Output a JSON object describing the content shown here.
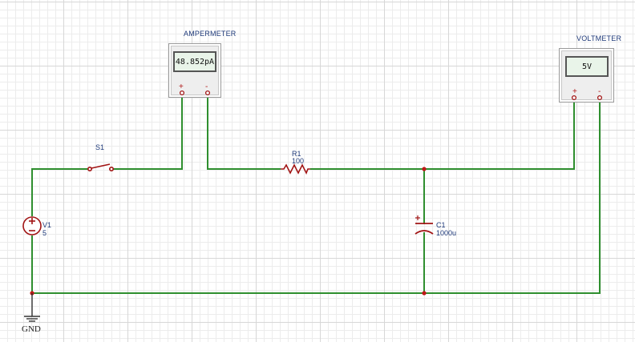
{
  "ammeter": {
    "title": "AMPERMETER",
    "reading": "48.852pA",
    "plus": "+",
    "minus": "-"
  },
  "voltmeter": {
    "title": "VOLTMETER",
    "reading": "5V",
    "plus": "+",
    "minus": "-"
  },
  "switch": {
    "label": "S1"
  },
  "resistor": {
    "label": "R1",
    "value": "100"
  },
  "capacitor": {
    "label": "C1",
    "value": "1000u"
  },
  "source": {
    "label": "V1",
    "value": "5"
  },
  "ground": {
    "label": "GND"
  },
  "colors": {
    "wire": "#2f8f2f",
    "component": "#a11414",
    "label": "#1f3a7a",
    "grid": "#d7d7d7"
  }
}
